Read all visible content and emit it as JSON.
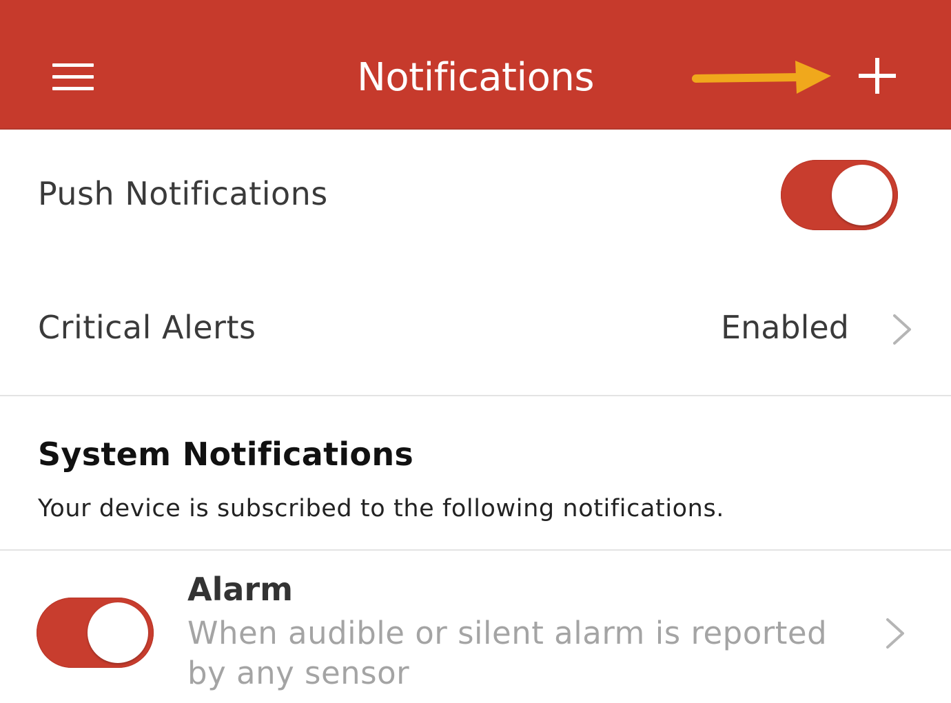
{
  "header": {
    "title": "Notifications",
    "menu_icon": "hamburger-menu-icon",
    "add_icon": "plus-icon",
    "background_color": "#c63a2c",
    "annotation_color": "#f0a81c"
  },
  "settings": {
    "push": {
      "label": "Push Notifications",
      "enabled": true
    },
    "critical": {
      "label": "Critical Alerts",
      "value": "Enabled",
      "icon": "chevron-right-icon"
    }
  },
  "system": {
    "title": "System Notifications",
    "description": "Your device is subscribed to the following notifications.",
    "items": [
      {
        "title": "Alarm",
        "description": "When audible or silent alarm is reported by any sensor",
        "enabled": true,
        "icon": "chevron-right-icon"
      }
    ]
  }
}
